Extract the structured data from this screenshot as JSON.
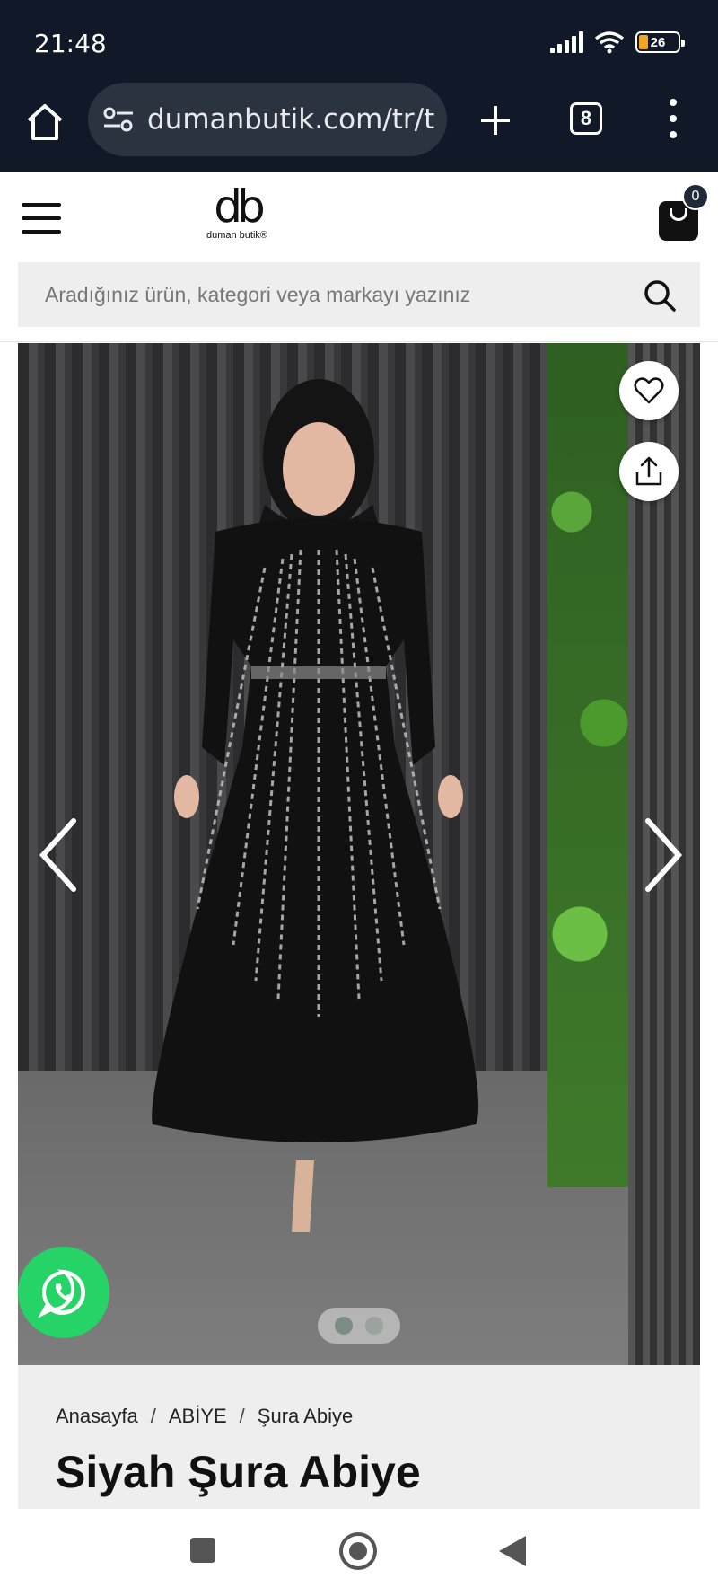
{
  "status_bar": {
    "time": "21:48",
    "battery": "26"
  },
  "browser": {
    "url": "dumanbutik.com/tr/tr/",
    "tab_count": "8"
  },
  "site": {
    "logo_mark": "db",
    "logo_name": "duman butik®",
    "cart_count": "0"
  },
  "search": {
    "placeholder": "Aradığınız ürün, kategori veya markayı yazınız"
  },
  "gallery": {
    "total_images": 2,
    "active_image": 1
  },
  "breadcrumb": {
    "items": [
      "Anasayfa",
      "ABİYE",
      "Şura Abiye"
    ],
    "separator": "/"
  },
  "product": {
    "title": "Siyah Şura Abiye"
  },
  "colors": {
    "browser_chrome": "#111827",
    "whatsapp": "#25d366",
    "info_bg": "#eeeeee"
  }
}
